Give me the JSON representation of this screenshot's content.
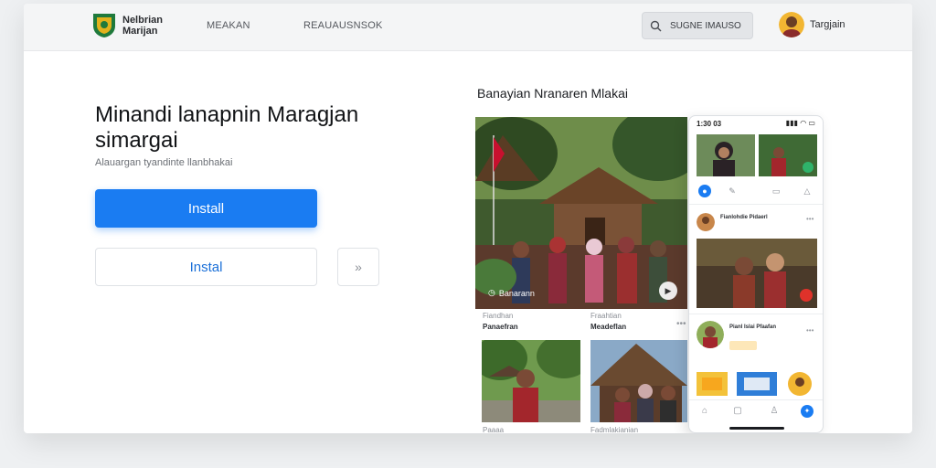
{
  "header": {
    "brand_line1": "Nelbrian",
    "brand_line2": "Marijan",
    "nav": [
      "MEAKAN",
      "REAUAUSNSOK"
    ],
    "search_text": "SUGNE  IMAUSO",
    "username": "Targjain"
  },
  "hero": {
    "title": "Minandi lanapnin Maragjan simargai",
    "subtitle": "Alauargan tyandinte llanbhakai",
    "install_label": "Install",
    "instal_label": "Instal",
    "next_label": "»"
  },
  "gallery": {
    "title": "Banayian Nranaren Mlakai",
    "overlay_label": "Banarann",
    "captions": [
      {
        "small": "Fiandhan",
        "bold": "Panaefran"
      },
      {
        "small": "Fraahtian",
        "bold": "Meadeflan"
      },
      {
        "small": "Paaaa",
        "bold": ""
      },
      {
        "small": "Fadmlakianian",
        "bold": ""
      }
    ]
  },
  "phone": {
    "time": "1:30 03",
    "signal": "▮▮▮ ◠ ▭",
    "post1_name": "Fianlohdie Pidaerl",
    "post2_name": "Pianl Islai Pfaafan"
  },
  "colors": {
    "accent": "#1a7cf2",
    "logo_green": "#1f7a3c",
    "logo_gold": "#e2b21c"
  }
}
